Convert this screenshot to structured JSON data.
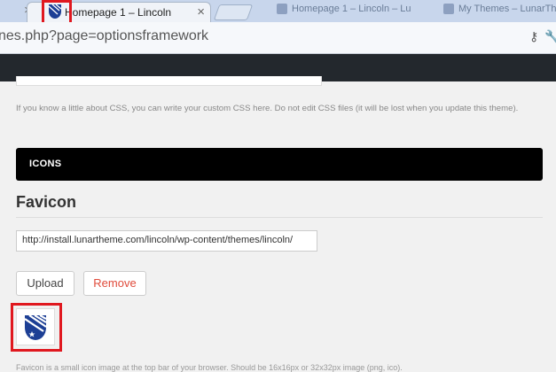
{
  "browser": {
    "tab_active_title": "Homepage 1 – Lincoln",
    "tab_close": "×",
    "faded_tab_1": "Homepage 1 – Lincoln – Lu",
    "faded_tab_2": "My Themes – LunarTh",
    "url": "nes.php?page=optionsframework"
  },
  "page": {
    "help_text": "If you know a little about CSS, you can write your custom CSS here. Do not edit CSS files (it will be lost when you update this theme).",
    "section_header": "ICONS",
    "field_title": "Favicon",
    "favicon_url_value": "http://install.lunartheme.com/lincoln/wp-content/themes/lincoln/",
    "upload_label": "Upload",
    "remove_label": "Remove",
    "cut_text": "Favicon is a small icon image at the top bar of your browser. Should be 16x16px or 32x32px image (png, ico)."
  },
  "colors": {
    "highlight": "#e0181f",
    "shield_blue": "#1d3f95",
    "remove_red": "#e04b3b"
  },
  "icons": [
    "key-icon",
    "wrench-icon",
    "shield-favicon-icon"
  ]
}
